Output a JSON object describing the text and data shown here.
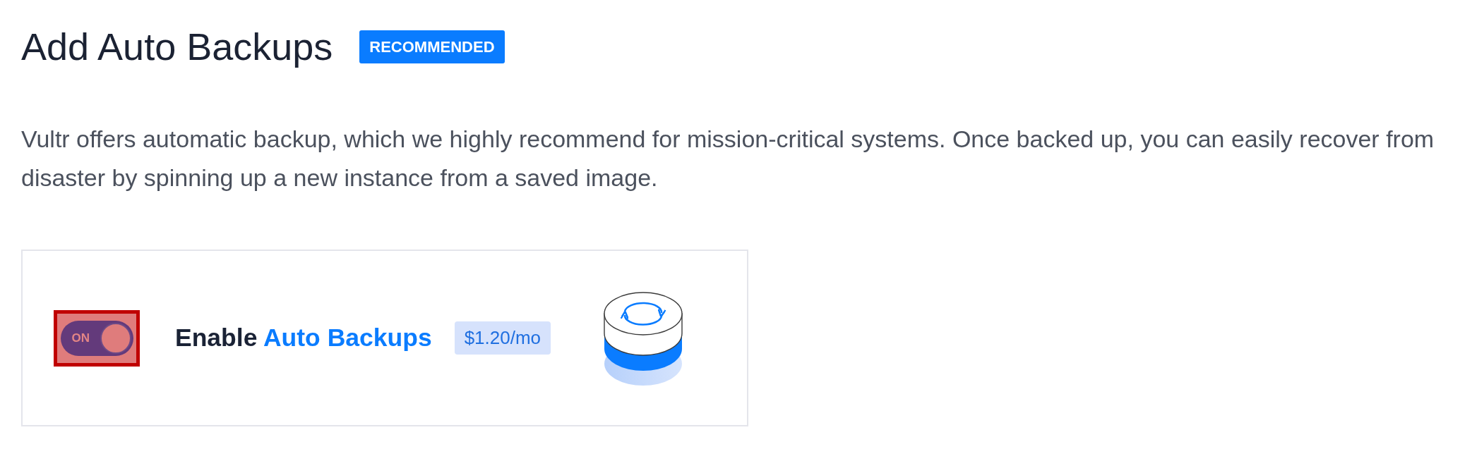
{
  "section": {
    "title": "Add Auto Backups",
    "badge": "RECOMMENDED",
    "description": "Vultr offers automatic backup, which we highly recommend for mission-critical systems. Once backed up, you can easily recover from disaster by spinning up a new instance from a saved image."
  },
  "backup_option": {
    "toggle": {
      "label": "ON",
      "on": true,
      "highlighted": true
    },
    "label": {
      "text": "Enable",
      "highlight": "Auto Backups"
    },
    "price": "$1.20/mo"
  }
}
